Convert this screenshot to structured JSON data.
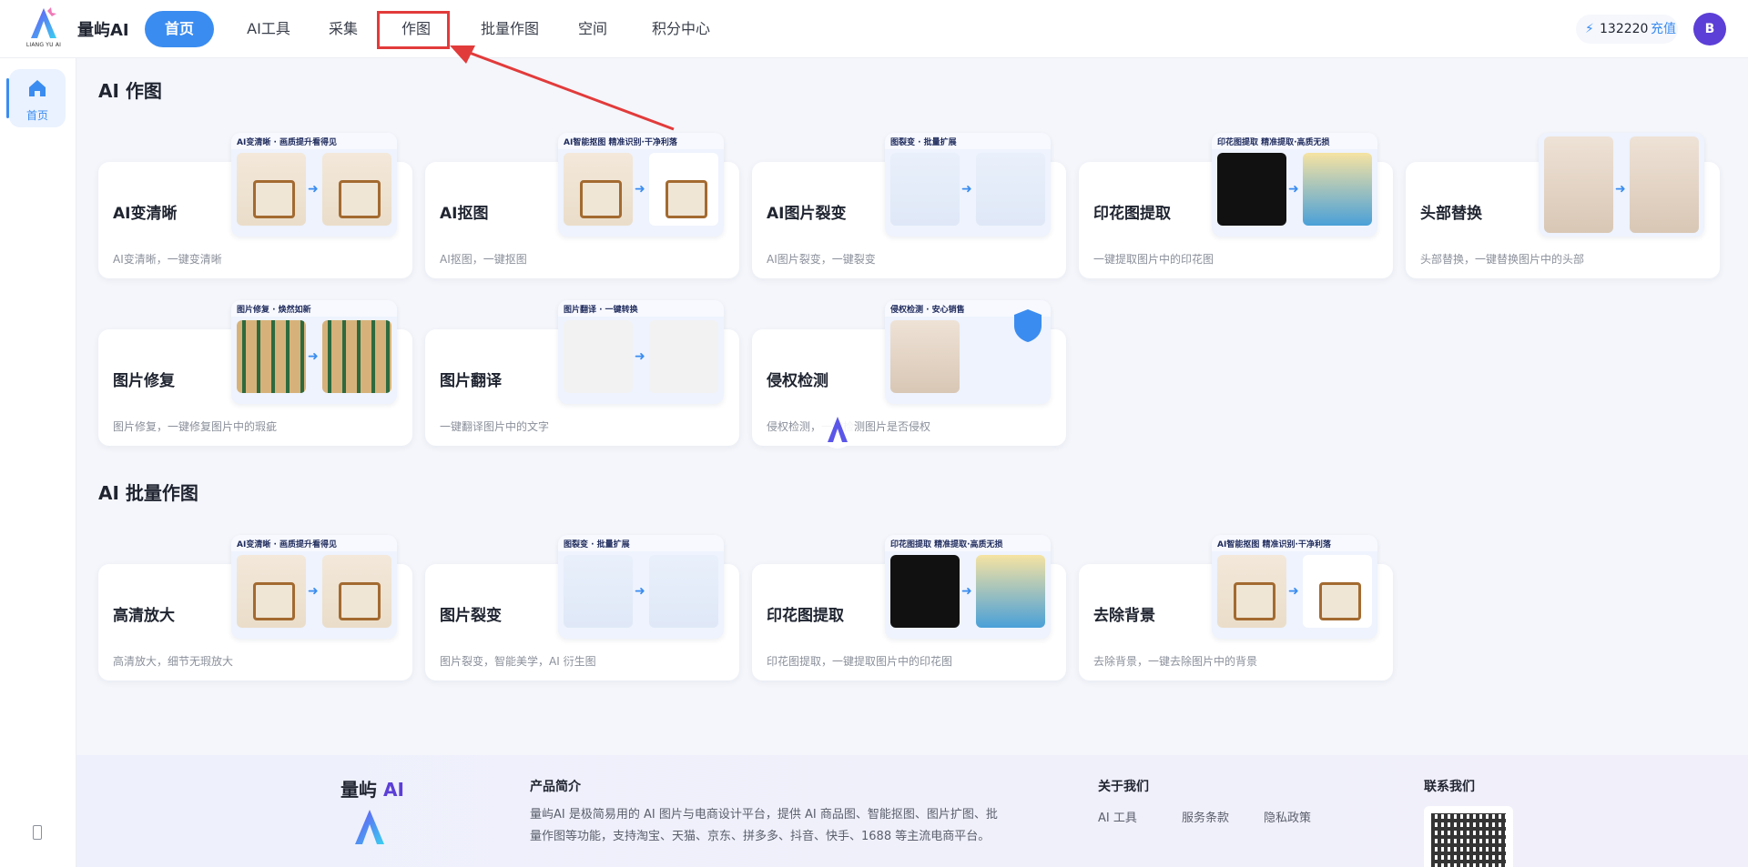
{
  "app": {
    "brand": "量屿AI",
    "logo_text": "量屿AI",
    "logo_sub": "LIANG YU AI"
  },
  "nav": [
    {
      "label": "首页",
      "active": true
    },
    {
      "label": "AI工具"
    },
    {
      "label": "采集"
    },
    {
      "label": "作图",
      "highlighted": true
    },
    {
      "label": "批量作图"
    },
    {
      "label": "空间"
    },
    {
      "label": "积分中心"
    }
  ],
  "account": {
    "points": "132220",
    "recharge": "充值",
    "avatar": "B"
  },
  "sidebar": {
    "home_label": "首页"
  },
  "sections": {
    "ai_draw": "AI 作图",
    "batch": "AI 批量作图"
  },
  "cards_ai": [
    {
      "title": "AI变清晰",
      "desc": "AI变清晰，一键变清晰",
      "thumb_caption": "AI变清晰 · 画质提升看得见"
    },
    {
      "title": "AI抠图",
      "desc": "AI抠图，一键抠图",
      "thumb_caption": "AI智能抠图 精准识别·干净利落"
    },
    {
      "title": "AI图片裂变",
      "desc": "AI图片裂变，一键裂变",
      "thumb_caption": "图裂变 · 批量扩展"
    },
    {
      "title": "印花图提取",
      "desc": "一键提取图片中的印花图",
      "thumb_caption": "印花图提取 精准提取·高质无损"
    },
    {
      "title": "头部替换",
      "desc": "头部替换，一键替换图片中的头部",
      "thumb_caption": ""
    },
    {
      "title": "图片修复",
      "desc": "图片修复，一键修复图片中的瑕疵",
      "thumb_caption": "图片修复 · 焕然如新"
    },
    {
      "title": "图片翻译",
      "desc": "一键翻译图片中的文字",
      "thumb_caption": "图片翻译 · 一键转换"
    },
    {
      "title": "侵权检测",
      "desc": "侵权检测，一键检测图片是否侵权",
      "thumb_caption": "侵权检测 · 安心销售"
    }
  ],
  "cards_batch": [
    {
      "title": "高清放大",
      "desc": "高清放大，细节无瑕放大",
      "thumb_caption": "AI变清晰 · 画质提升看得见"
    },
    {
      "title": "图片裂变",
      "desc": "图片裂变，智能美学，AI 衍生图",
      "thumb_caption": "图裂变 · 批量扩展"
    },
    {
      "title": "印花图提取",
      "desc": "印花图提取，一键提取图片中的印花图",
      "thumb_caption": "印花图提取 精准提取·高质无损"
    },
    {
      "title": "去除背景",
      "desc": "去除背景，一键去除图片中的背景",
      "thumb_caption": "AI智能抠图 精准识别·干净利落"
    }
  ],
  "footer": {
    "brand_main": "量屿",
    "brand_ai": "AI",
    "logo_text": "量屿AI",
    "intro_title": "产品简介",
    "intro_text": "量屿AI 是极简易用的 AI 图片与电商设计平台，提供 AI 商品图、智能抠图、图片扩图、批量作图等功能，支持淘宝、天猫、京东、拼多多、抖音、快手、1688 等主流电商平台。",
    "about_title": "关于我们",
    "about_links": [
      "AI 工具",
      "服务条款",
      "隐私政策"
    ],
    "contact_title": "联系我们"
  },
  "colors": {
    "accent": "#3a8cf0",
    "highlight": "#e23b3b",
    "avatar": "#5b3fd6"
  }
}
